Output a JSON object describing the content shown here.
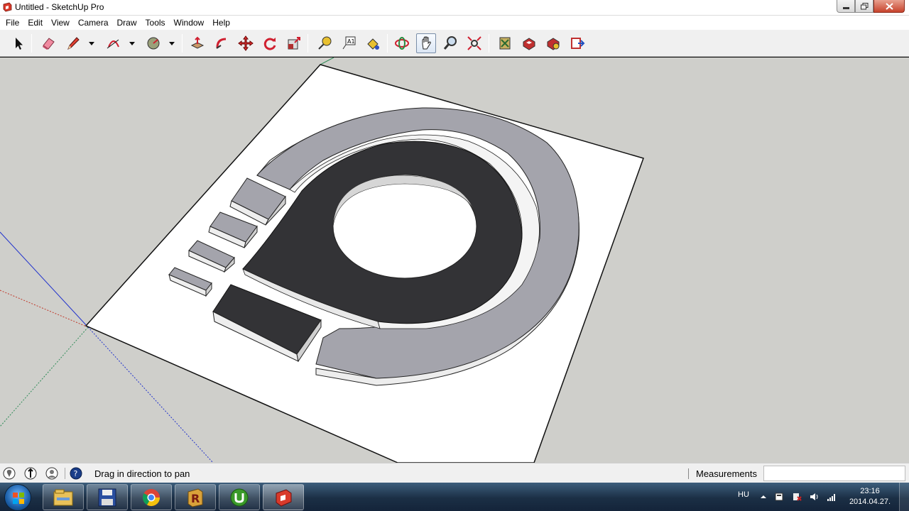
{
  "window": {
    "title": "Untitled - SketchUp Pro",
    "buttons": {
      "minimize": "minimize-icon",
      "maximize": "restore-icon",
      "close": "close-icon"
    }
  },
  "menu": {
    "items": [
      "File",
      "Edit",
      "View",
      "Camera",
      "Draw",
      "Tools",
      "Window",
      "Help"
    ]
  },
  "toolbar": {
    "tools": [
      "select-icon",
      "eraser-icon",
      "pencil-icon",
      "arc-icon",
      "shape-icon",
      "push-pull-icon",
      "follow-me-icon",
      "move-icon",
      "rotate-icon",
      "scale-icon",
      "tape-measure-icon",
      "text-icon",
      "paint-bucket-icon",
      "orbit-icon",
      "pan-icon",
      "zoom-icon",
      "zoom-extents-icon",
      "warehouse-icon",
      "components-icon",
      "extension-icon",
      "send-to-layout-icon"
    ],
    "active_tool": "pan-icon"
  },
  "status": {
    "hint": "Drag in direction to pan",
    "measurements_label": "Measurements",
    "measurements_value": ""
  },
  "taskbar": {
    "apps": [
      "explorer-icon",
      "save-icon",
      "chrome-icon",
      "r-app-icon",
      "utorrent-icon",
      "sketchup-icon"
    ],
    "active_app": "sketchup-icon",
    "language": "HU",
    "time": "23:16",
    "date": "2014.04.27."
  },
  "colors": {
    "viewport_bg": "#cfcfcb",
    "base_plate": "#ffffff",
    "ring_gray": "#a4a4ac",
    "dark_shape": "#333336",
    "axis_red": "#c0392b",
    "axis_green": "#2e8b57",
    "axis_blue": "#2233cc"
  }
}
